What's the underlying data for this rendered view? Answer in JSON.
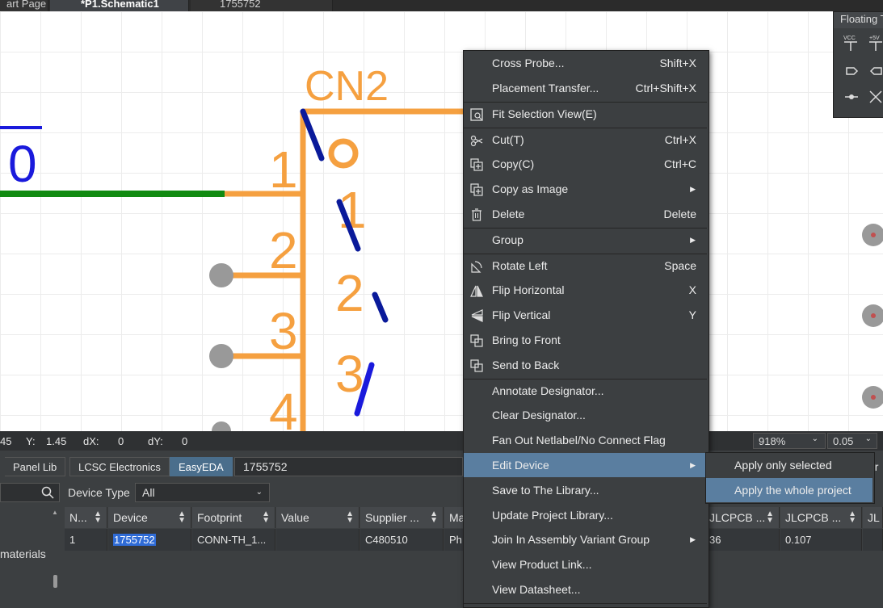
{
  "tabs": [
    {
      "label": "art Page"
    },
    {
      "label": "*P1.Schematic1"
    },
    {
      "label": "1755752"
    }
  ],
  "floating_panel": {
    "title": "Floating T",
    "vcc_label": "VCC",
    "plus5v_label": "+5V"
  },
  "schematic": {
    "designator": "CN2",
    "net_label": "0",
    "pins_outer": [
      "1",
      "2",
      "3",
      "4"
    ],
    "pins_inner": [
      "1",
      "2",
      "3"
    ],
    "colors": {
      "component": "#f5a040",
      "wire": "#118a11",
      "netlabel": "#1a1adc",
      "symbol": "#0a1a9a"
    }
  },
  "statusbar": {
    "x_value": "45",
    "y_label": "Y:",
    "y_value": "1.45",
    "dx_label": "dX:",
    "dx_value": "0",
    "dy_label": "dY:",
    "dy_value": "0",
    "zoom": "918%",
    "grid": "0.05"
  },
  "library": {
    "panel_lib": "Panel Lib",
    "lcsc": "LCSC Electronics",
    "easyeda": "EasyEDA",
    "search_value": "1755752",
    "device_type_label": "Device Type",
    "device_type_value": "All",
    "left_item": "materials",
    "right_partial": "or"
  },
  "table": {
    "headers": [
      "N...",
      "Device",
      "Footprint",
      "Value",
      "Supplier ...",
      "Ma",
      "JLCPCB ...",
      "JLCPCB ...",
      "JL"
    ],
    "row": [
      "1",
      "1755752",
      "CONN-TH_1...",
      "",
      "C480510",
      "Ph",
      "36",
      "0.107",
      ""
    ]
  },
  "context_menu": {
    "items": [
      {
        "label": "Cross Probe...",
        "shortcut": "Shift+X"
      },
      {
        "label": "Placement Transfer...",
        "shortcut": "Ctrl+Shift+X"
      },
      {
        "label": "Fit Selection View(E)",
        "shortcut": ""
      },
      {
        "label": "Cut(T)",
        "shortcut": "Ctrl+X"
      },
      {
        "label": "Copy(C)",
        "shortcut": "Ctrl+C"
      },
      {
        "label": "Copy as Image",
        "shortcut": ""
      },
      {
        "label": "Delete",
        "shortcut": "Delete"
      },
      {
        "label": "Group",
        "shortcut": ""
      },
      {
        "label": "Rotate Left",
        "shortcut": "Space"
      },
      {
        "label": "Flip Horizontal",
        "shortcut": "X"
      },
      {
        "label": "Flip Vertical",
        "shortcut": "Y"
      },
      {
        "label": "Bring to Front",
        "shortcut": ""
      },
      {
        "label": "Send to Back",
        "shortcut": ""
      },
      {
        "label": "Annotate Designator...",
        "shortcut": ""
      },
      {
        "label": "Clear Designator...",
        "shortcut": ""
      },
      {
        "label": "Fan Out Netlabel/No Connect Flag",
        "shortcut": ""
      },
      {
        "label": "Edit Device",
        "shortcut": ""
      },
      {
        "label": "Save to The Library...",
        "shortcut": ""
      },
      {
        "label": "Update Project Library...",
        "shortcut": ""
      },
      {
        "label": "Join In Assembly Variant Group",
        "shortcut": ""
      },
      {
        "label": "View Product Link...",
        "shortcut": ""
      },
      {
        "label": "View Datasheet...",
        "shortcut": ""
      }
    ],
    "submenu": [
      "Apply only selected",
      "Apply the whole project"
    ]
  }
}
